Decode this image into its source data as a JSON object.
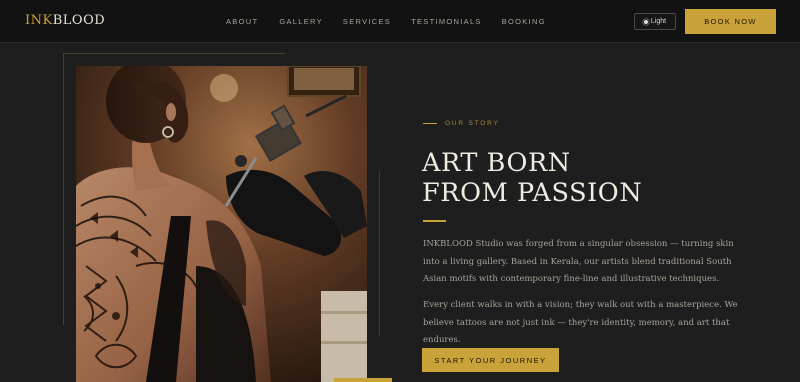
{
  "brand": {
    "logo_prefix": "INK",
    "logo_suffix": "BLOOD"
  },
  "nav": {
    "links": [
      "ABOUT",
      "GALLERY",
      "SERVICES",
      "TESTIMONIALS",
      "BOOKING"
    ],
    "theme_toggle": "Light",
    "book_button": "BOOK NOW"
  },
  "hero": {
    "eyebrow": "OUR STORY",
    "headline_line1": "ART BORN",
    "headline_line2": "FROM PASSION",
    "paragraph1": "INKBLOOD Studio was forged from a singular obsession — turning skin into a living gallery. Based in Kerala, our artists blend traditional South Asian motifs with contemporary fine-line and illustrative techniques.",
    "paragraph2": "Every client walks in with a vision; they walk out with a masterpiece. We believe tattoos are not just ink — they're identity, memory, and art that endures.",
    "cta": "START YOUR JOURNEY",
    "image_alt": "tattoo-artist-photo"
  },
  "colors": {
    "accent": "#c9a23a",
    "background": "#1e1e1e",
    "nav_bg": "#121212"
  }
}
